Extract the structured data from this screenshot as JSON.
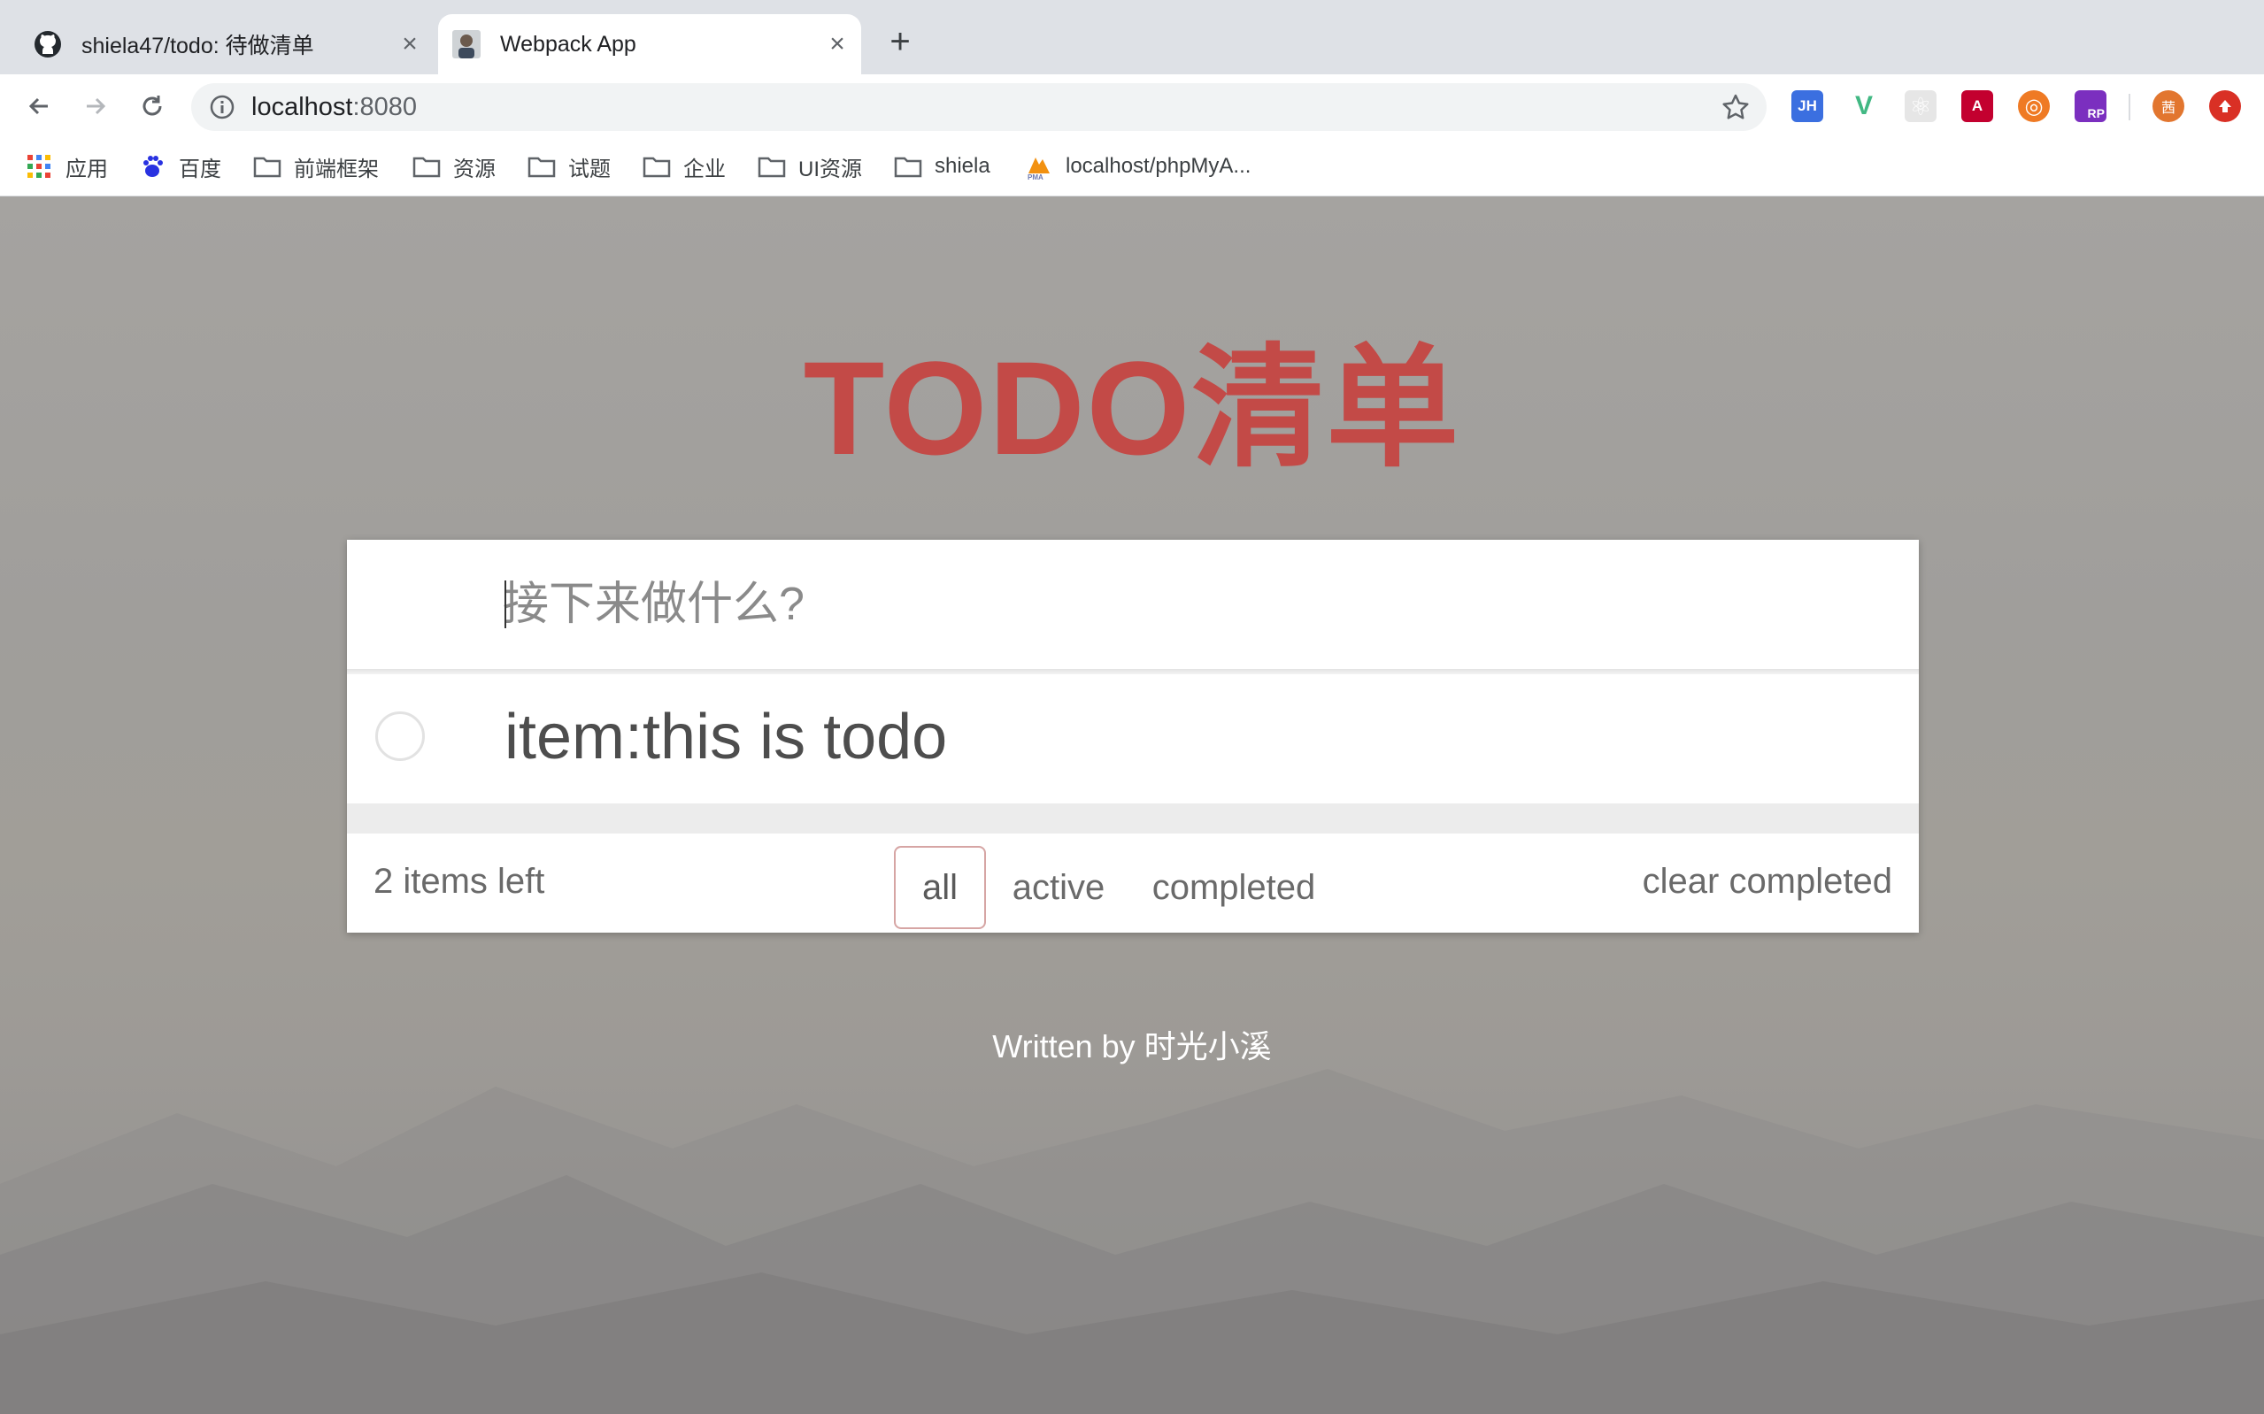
{
  "browser": {
    "tabs": [
      {
        "title": "shiela47/todo: 待做清单",
        "icon": "github-icon",
        "active": false
      },
      {
        "title": "Webpack App",
        "icon": "avatar-favicon",
        "active": true
      }
    ],
    "new_tab_label": "+",
    "close_glyph": "×",
    "address": {
      "host": "localhost",
      "port": ":8080"
    },
    "bookmarks": [
      {
        "label": "应用",
        "icon": "apps-grid-icon"
      },
      {
        "label": "百度",
        "icon": "baidu-paw-icon"
      },
      {
        "label": "前端框架",
        "icon": "folder-icon"
      },
      {
        "label": "资源",
        "icon": "folder-icon"
      },
      {
        "label": "试题",
        "icon": "folder-icon"
      },
      {
        "label": "企业",
        "icon": "folder-icon"
      },
      {
        "label": "UI资源",
        "icon": "folder-icon"
      },
      {
        "label": "shiela",
        "icon": "folder-icon"
      },
      {
        "label": "localhost/phpMyA...",
        "icon": "phpmyadmin-icon"
      }
    ],
    "extensions": [
      {
        "name": "jh-extension-icon",
        "glyph": "JH",
        "color": "#3b6fe0"
      },
      {
        "name": "vue-devtools-icon",
        "glyph": "V",
        "color": "#41b883"
      },
      {
        "name": "react-devtools-icon",
        "glyph": "⚛",
        "color": "#d6d6d6"
      },
      {
        "name": "angular-icon",
        "glyph": "A",
        "color": "#c3002f"
      },
      {
        "name": "lifebuoy-extension-icon",
        "glyph": "◎",
        "color": "#ef7a24"
      },
      {
        "name": "axure-rp-icon",
        "glyph": "RP",
        "color": "#7b2fbf"
      }
    ],
    "profile_glyph": "茜",
    "profile_color": "#e2762f",
    "update_color": "#d93025"
  },
  "app": {
    "title": "TODO清单",
    "input_placeholder": "接下来做什么?",
    "todos": [
      {
        "text": "item:this is todo",
        "completed": false
      }
    ],
    "items_left": "2 items left",
    "filters": [
      "all",
      "active",
      "completed"
    ],
    "selected_filter": "all",
    "clear_completed": "clear completed",
    "credit": "Written by 时光小溪",
    "accent_color": "#c34a47"
  }
}
